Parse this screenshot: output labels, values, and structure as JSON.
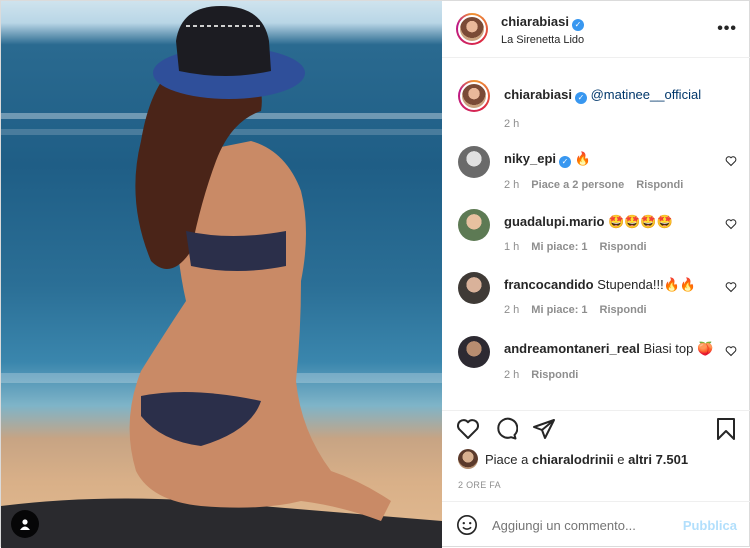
{
  "post": {
    "username": "chiarabiasi",
    "location": "La Sirenetta Lido",
    "more_icon": "more-horizontal-icon"
  },
  "caption": {
    "username": "chiarabiasi",
    "mention": "@matinee__official",
    "time": "2 h"
  },
  "comments": [
    {
      "username": "niky_epi",
      "text": "🔥",
      "time": "2 h",
      "likes": "Piace a 2 persone",
      "reply": "Rispondi",
      "verified": true
    },
    {
      "username": "guadalupi.mario",
      "text": "🤩🤩🤩🤩",
      "time": "1 h",
      "likes": "Mi piace: 1",
      "reply": "Rispondi",
      "verified": false
    },
    {
      "username": "francocandido",
      "text": "Stupenda!!!🔥🔥",
      "time": "2 h",
      "likes": "Mi piace: 1",
      "reply": "Rispondi",
      "verified": false
    },
    {
      "username": "andreamontaneri_real",
      "text": "Biasi top 🍑",
      "time": "2 h",
      "likes": "",
      "reply": "Rispondi",
      "verified": false
    }
  ],
  "likes": {
    "prefix": "Piace a",
    "user": "chiaralodrinii",
    "suffix": "e",
    "others": "altri 7.501"
  },
  "posted_ago": "2 ORE FA",
  "add_comment": {
    "placeholder": "Aggiungi un commento...",
    "publish": "Pubblica"
  },
  "colors": {
    "accent_blue": "#0095f6",
    "publish_disabled": "#b2dffc",
    "muted": "#8e8e8e"
  }
}
